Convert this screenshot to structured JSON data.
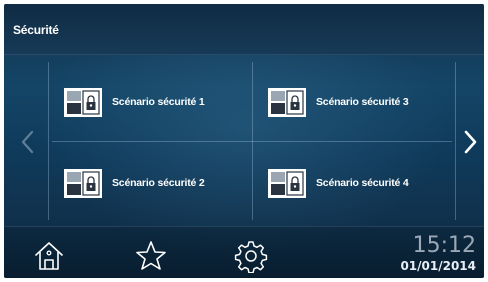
{
  "header": {
    "title": "Sécurité"
  },
  "scenarios": [
    {
      "label": "Scénario sécurité 1",
      "icon": "security-scenario-icon"
    },
    {
      "label": "Scénario sécurité 3",
      "icon": "security-scenario-icon"
    },
    {
      "label": "Scénario sécurité 2",
      "icon": "security-scenario-icon"
    },
    {
      "label": "Scénario sécurité 4",
      "icon": "security-scenario-icon"
    }
  ],
  "navigation": {
    "prev_icon": "chevron-left-icon",
    "next_icon": "chevron-right-icon"
  },
  "footer": {
    "home_icon": "home-icon",
    "favorites_icon": "star-icon",
    "settings_icon": "gear-icon",
    "time": "15:12",
    "date": "01/01/2014"
  },
  "colors": {
    "background": "#144566",
    "text": "#ffffff",
    "time_text": "#9aa8b8"
  }
}
